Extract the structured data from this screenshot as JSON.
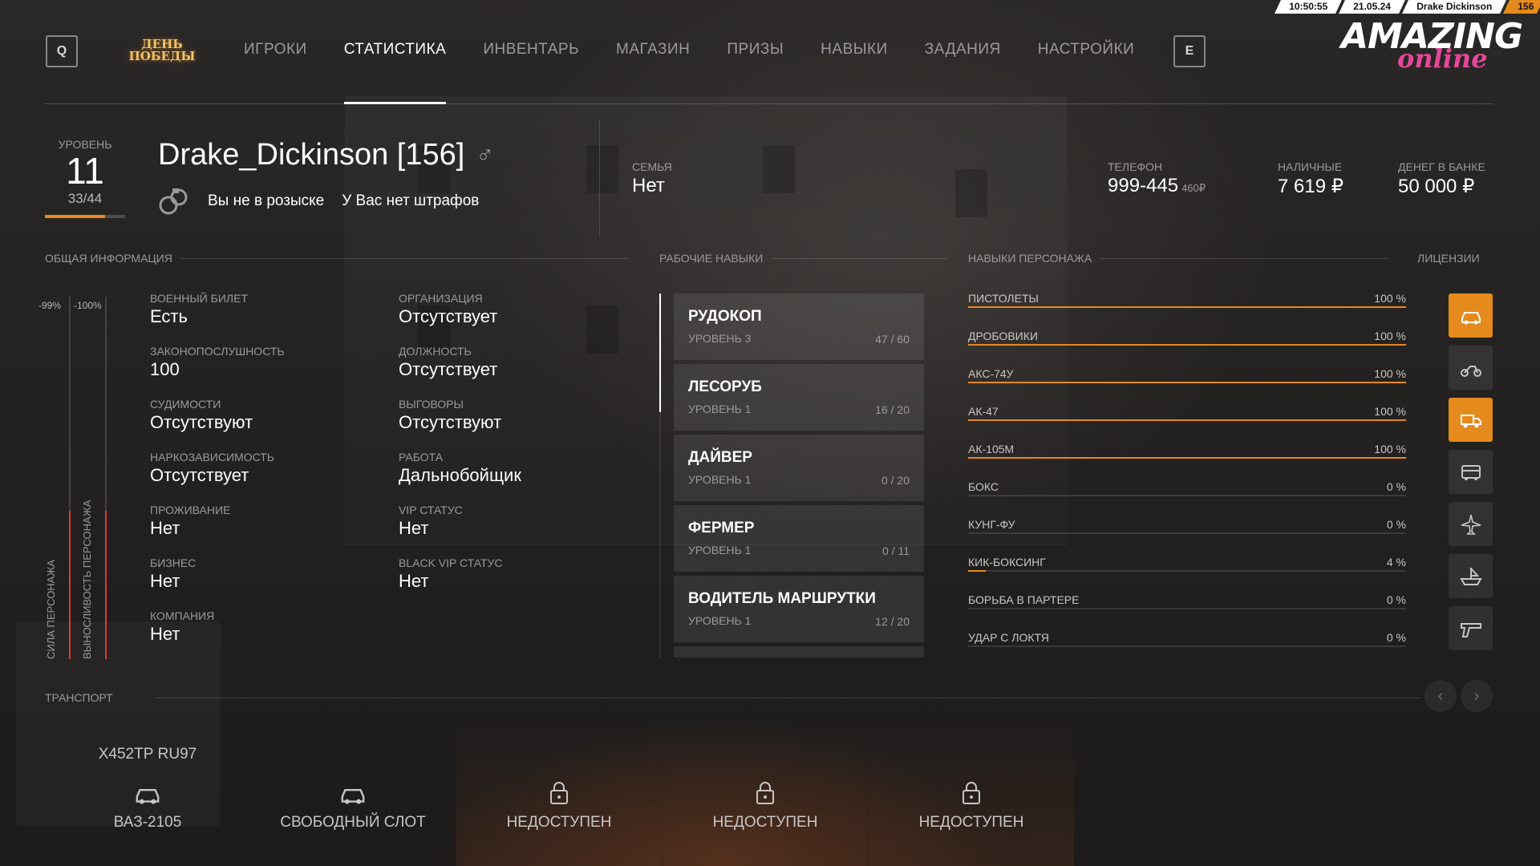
{
  "status_bar": {
    "time": "10:50:55",
    "date": "21.05.24",
    "player": "Drake Dickinson",
    "server": "156"
  },
  "nav": {
    "key_left": "Q",
    "key_right": "E",
    "event_logo_line1": "ДЕНЬ",
    "event_logo_line2": "ПОБЕДЫ",
    "items": [
      "ИГРОКИ",
      "СТАТИСТИКА",
      "ИНВЕНТАРЬ",
      "МАГАЗИН",
      "ПРИЗЫ",
      "НАВЫКИ",
      "ЗАДАНИЯ",
      "НАСТРОЙКИ"
    ],
    "active": "СТАТИСТИКА"
  },
  "brand": {
    "top": "AMAZING",
    "bottom": "online"
  },
  "profile": {
    "level_label": "УРОВЕНЬ",
    "level": "11",
    "xp": "33/44",
    "xp_fraction": 0.75,
    "name": "Drake_Dickinson [156]",
    "gender_icon": "male-icon",
    "wanted": "Вы не в розыске",
    "fines": "У Вас нет штрафов",
    "family_label": "СЕМЬЯ",
    "family": "Нет",
    "phone_label": "ТЕЛЕФОН",
    "phone": "999-445",
    "phone_balance": "460₽",
    "cash_label": "НАЛИЧНЫЕ",
    "cash": "7 619 ₽",
    "bank_label": "ДЕНЕГ В БАНКЕ",
    "bank": "50 000 ₽"
  },
  "sections": {
    "general": "ОБЩАЯ ИНФОРМАЦИЯ",
    "work": "РАБОЧИЕ НАВЫКИ",
    "character": "НАВЫКИ ПЕРСОНАЖА",
    "licenses": "ЛИЦЕНЗИИ",
    "transport": "ТРАНСПОРТ"
  },
  "bars": {
    "strength_label": "СИЛА ПЕРСОНАЖА",
    "strength_pct": "-99%",
    "strength_fill": 0.41,
    "endurance_label": "ВЫНОСЛИВОСТЬ ПЕРСОНАЖА",
    "endurance_pct": "-100%",
    "endurance_fill": 0.41
  },
  "general_info": [
    {
      "label": "ВОЕННЫЙ БИЛЕТ",
      "value": "Есть"
    },
    {
      "label": "ЗАКОНОПОСЛУШНОСТЬ",
      "value": "100"
    },
    {
      "label": "СУДИМОСТИ",
      "value": "Отсутствуют"
    },
    {
      "label": "НАРКОЗАВИСИМОСТЬ",
      "value": "Отсутствует"
    },
    {
      "label": "ПРОЖИВАНИЕ",
      "value": "Нет"
    },
    {
      "label": "БИЗНЕС",
      "value": "Нет"
    },
    {
      "label": "КОМПАНИЯ",
      "value": "Нет"
    },
    {
      "label": "ОРГАНИЗАЦИЯ",
      "value": "Отсутствует"
    },
    {
      "label": "ДОЛЖНОСТЬ",
      "value": "Отсутствует"
    },
    {
      "label": "ВЫГОВОРЫ",
      "value": "Отсутствуют"
    },
    {
      "label": "РАБОТА",
      "value": "Дальнобойщик"
    },
    {
      "label": "VIP СТАТУС",
      "value": "Нет"
    },
    {
      "label": "BLACK VIP СТАТУС",
      "value": "Нет"
    }
  ],
  "work_skills": [
    {
      "name": "РУДОКОП",
      "level": "УРОВЕНЬ 3",
      "progress": "47 / 60"
    },
    {
      "name": "ЛЕСОРУБ",
      "level": "УРОВЕНЬ 1",
      "progress": "16 / 20"
    },
    {
      "name": "ДАЙВЕР",
      "level": "УРОВЕНЬ 1",
      "progress": "0 / 20"
    },
    {
      "name": "ФЕРМЕР",
      "level": "УРОВЕНЬ 1",
      "progress": "0 / 11"
    },
    {
      "name": "ВОДИТЕЛЬ МАРШРУТКИ",
      "level": "УРОВЕНЬ 1",
      "progress": "12 / 20"
    }
  ],
  "character_skills": [
    {
      "name": "ПИСТОЛЕТЫ",
      "pct": "100 %",
      "value": 100
    },
    {
      "name": "ДРОБОВИКИ",
      "pct": "100 %",
      "value": 100
    },
    {
      "name": "АКС-74У",
      "pct": "100 %",
      "value": 100
    },
    {
      "name": "АК-47",
      "pct": "100 %",
      "value": 100
    },
    {
      "name": "АК-105М",
      "pct": "100 %",
      "value": 100
    },
    {
      "name": "БОКС",
      "pct": "0 %",
      "value": 0
    },
    {
      "name": "КУНГ-ФУ",
      "pct": "0 %",
      "value": 0
    },
    {
      "name": "КИК-БОКСИНГ",
      "pct": "4 %",
      "value": 4
    },
    {
      "name": "БОРЬБА В ПАРТЕРЕ",
      "pct": "0 %",
      "value": 0
    },
    {
      "name": "УДАР С ЛОКТЯ",
      "pct": "0 %",
      "value": 0
    }
  ],
  "licenses": [
    {
      "icon": "car-icon",
      "active": true
    },
    {
      "icon": "motorcycle-icon",
      "active": false
    },
    {
      "icon": "truck-icon",
      "active": true
    },
    {
      "icon": "bus-icon",
      "active": false
    },
    {
      "icon": "plane-icon",
      "active": false
    },
    {
      "icon": "boat-icon",
      "active": false
    },
    {
      "icon": "pistol-icon",
      "active": false
    }
  ],
  "transport": [
    {
      "plate": "Х452ТР RU97",
      "name": "ВАЗ-2105",
      "icon": "car-icon",
      "locked": false
    },
    {
      "plate": "",
      "name": "СВОБОДНЫЙ СЛОТ",
      "icon": "car-icon",
      "locked": false
    },
    {
      "plate": "",
      "name": "НЕДОСТУПЕН",
      "icon": "lock-icon",
      "locked": true
    },
    {
      "plate": "",
      "name": "НЕДОСТУПЕН",
      "icon": "lock-icon",
      "locked": true
    },
    {
      "plate": "",
      "name": "НЕДОСТУПЕН",
      "icon": "lock-icon",
      "locked": true
    }
  ],
  "colors": {
    "accent": "#e58a1c",
    "danger": "#e23838",
    "brand_pink": "#e4479a"
  }
}
